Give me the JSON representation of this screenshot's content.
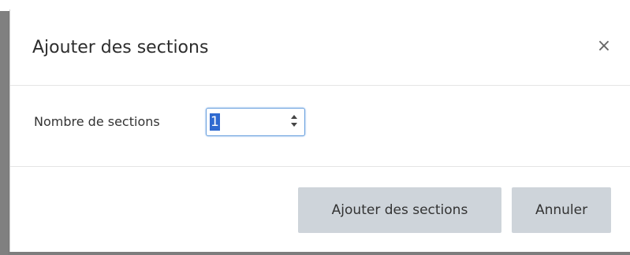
{
  "dialog": {
    "title": "Ajouter des sections",
    "close_glyph": "×",
    "field_label": "Nombre de sections",
    "field_value": "1",
    "primary_button": "Ajouter des sections",
    "cancel_button": "Annuler"
  },
  "icons": {
    "close": "close-icon",
    "spinner": "spinner-icon"
  },
  "colors": {
    "button_bg": "#ced4da",
    "input_focus": "#6aa0de",
    "selection": "#2f6ad0"
  }
}
